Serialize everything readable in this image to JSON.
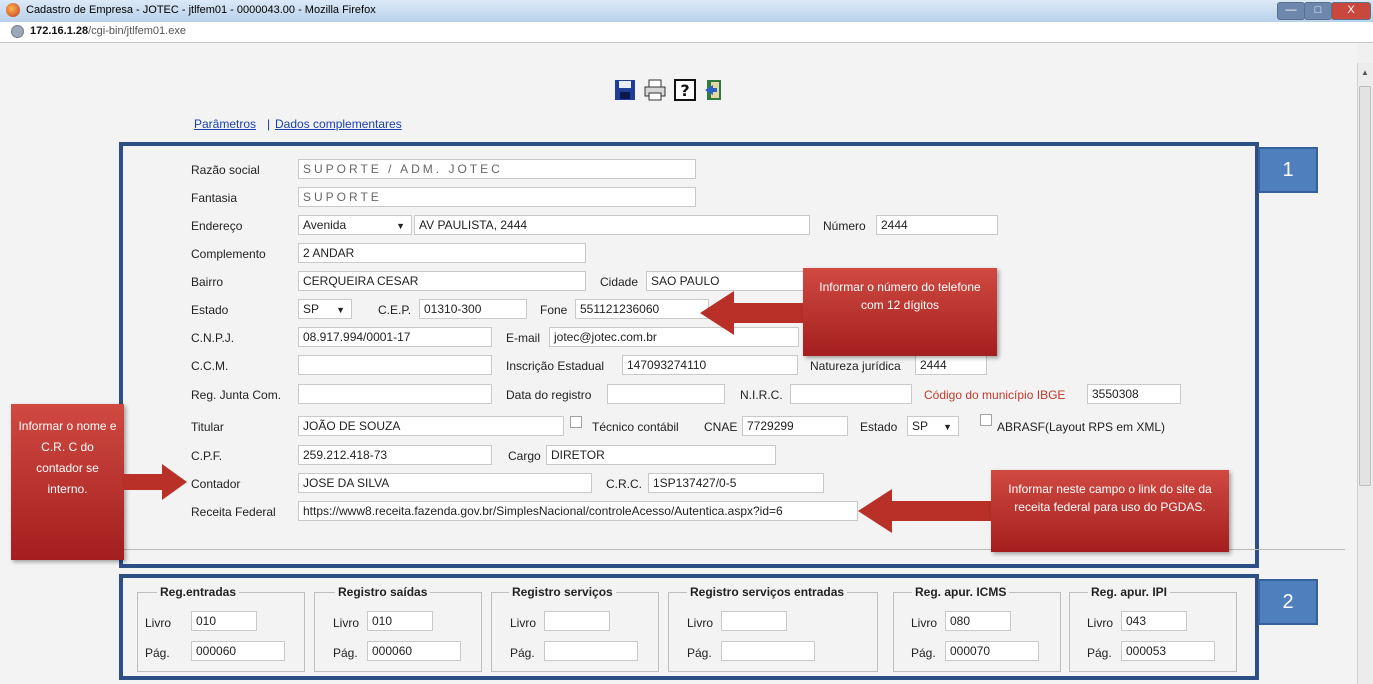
{
  "window": {
    "title": "Cadastro de Empresa - JOTEC - jtlfem01 - 0000043.00 - Mozilla Firefox",
    "controls": [
      "—",
      "□",
      "X"
    ]
  },
  "address": {
    "host": "172.16.1.28",
    "path": "/cgi-bin/jtlfem01.exe"
  },
  "toolbar": {
    "icons": [
      "save-icon",
      "print-icon",
      "help-icon",
      "exit-icon"
    ]
  },
  "links": {
    "params": "Parâmetros",
    "separator": "|",
    "extra": "Dados complementares"
  },
  "section1": {
    "badge": "1",
    "fields": {
      "razao_social": {
        "label": "Razão social",
        "value": "SUPORTE / ADM. JOTEC"
      },
      "fantasia": {
        "label": "Fantasia",
        "value": "SUPORTE"
      },
      "endereco": {
        "label": "Endereço",
        "tipo": "Avenida",
        "value": "AV PAULISTA, 2444"
      },
      "numero": {
        "label": "Número",
        "value": "2444"
      },
      "complemento": {
        "label": "Complemento",
        "value": "2 ANDAR"
      },
      "bairro": {
        "label": "Bairro",
        "value": "CERQUEIRA CESAR"
      },
      "cidade": {
        "label": "Cidade",
        "value": "SAO PAULO"
      },
      "estado": {
        "label": "Estado",
        "value": "SP"
      },
      "cep": {
        "label": "C.E.P.",
        "value": "01310-300"
      },
      "fone": {
        "label": "Fone",
        "value": "551121236060"
      },
      "cnpj": {
        "label": "C.N.P.J.",
        "value": "08.917.994/0001-17"
      },
      "email": {
        "label": "E-mail",
        "value": "jotec@jotec.com.br"
      },
      "ccm": {
        "label": "C.C.M.",
        "value": ""
      },
      "inscricao": {
        "label": "Inscrição Estadual",
        "value": "147093274110"
      },
      "natureza": {
        "label": "Natureza jurídica",
        "value": "2444"
      },
      "reg_junta": {
        "label": "Reg. Junta Com.",
        "value": ""
      },
      "data_registro": {
        "label": "Data do registro",
        "value": ""
      },
      "nirc": {
        "label": "N.I.R.C.",
        "value": ""
      },
      "codigo_ibge": {
        "label": "Código do município IBGE",
        "value": "3550308"
      },
      "titular": {
        "label": "Titular",
        "value": "JOÃO DE SOUZA"
      },
      "tecnico": {
        "label": "Técnico contábil"
      },
      "cnae": {
        "label": "CNAE",
        "value": "7729299"
      },
      "estado2": {
        "label": "Estado",
        "value": "SP"
      },
      "abrasf": {
        "label": "ABRASF(Layout RPS em XML)"
      },
      "cpf": {
        "label": "C.P.F.",
        "value": "259.212.418-73"
      },
      "cargo": {
        "label": "Cargo",
        "value": "DIRETOR"
      },
      "contador": {
        "label": "Contador",
        "value": "JOSE DA SILVA"
      },
      "crc": {
        "label": "C.R.C.",
        "value": "1SP137427/0-5"
      },
      "receita": {
        "label": "Receita Federal",
        "value": "https://www8.receita.fazenda.gov.br/SimplesNacional/controleAcesso/Autentica.aspx?id=6"
      }
    }
  },
  "callouts": {
    "fone": "Informar o número do telefone com 12 dígitos",
    "contador": "Informar o nome e C.R. C do contador se interno.",
    "receita": "Informar neste campo o link do site da receita federal para uso do PGDAS."
  },
  "section2": {
    "badge": "2",
    "groups": [
      {
        "legend": "Reg.entradas",
        "livro_label": "Livro",
        "livro": "010",
        "pag_label": "Pág.",
        "pag": "000060"
      },
      {
        "legend": "Registro saídas",
        "livro_label": "Livro",
        "livro": "010",
        "pag_label": "Pág.",
        "pag": "000060"
      },
      {
        "legend": "Registro serviços",
        "livro_label": "Livro",
        "livro": "",
        "pag_label": "Pág.",
        "pag": ""
      },
      {
        "legend": "Registro serviços entradas",
        "livro_label": "Livro",
        "livro": "",
        "pag_label": "Pág.",
        "pag": ""
      },
      {
        "legend": "Reg. apur. ICMS",
        "livro_label": "Livro",
        "livro": "080",
        "pag_label": "Pág.",
        "pag": "000070"
      },
      {
        "legend": "Reg. apur. IPI",
        "livro_label": "Livro",
        "livro": "043",
        "pag_label": "Pág.",
        "pag": "000053"
      }
    ]
  }
}
